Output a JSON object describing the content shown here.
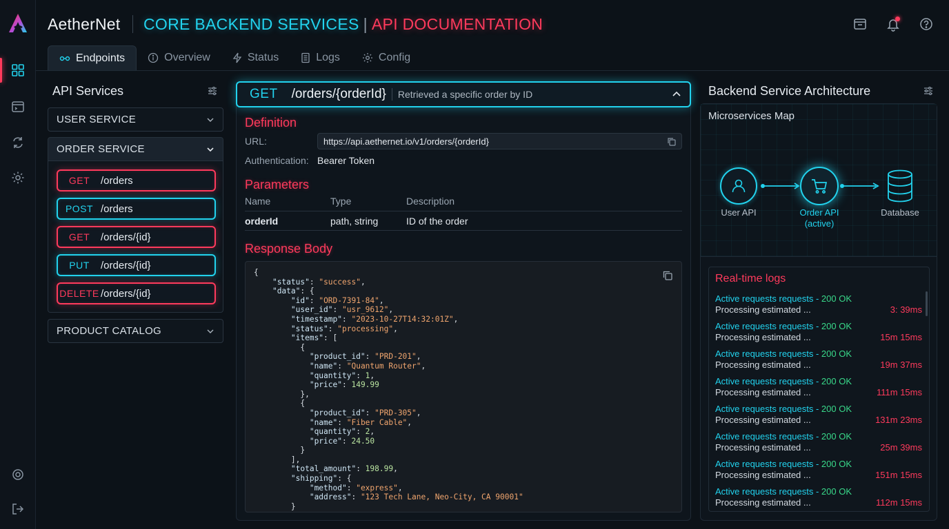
{
  "app": {
    "brand": "AetherNet",
    "title_part1": "CORE BACKEND SERVICES",
    "title_sep": "|",
    "title_part2": "API DOCUMENTATION"
  },
  "colors": {
    "accent_cyan": "#22d3ee",
    "accent_red": "#ff3a5c",
    "status_ok": "#39d98a",
    "background": "#0c1218"
  },
  "header_icons": [
    "archive-icon",
    "bell-icon",
    "help-icon"
  ],
  "rail_icons": [
    "dashboard-icon",
    "terminal-icon",
    "sync-icon",
    "gear-icon",
    "settings-icon",
    "logout-icon"
  ],
  "tabs": [
    {
      "label": "Endpoints",
      "icon": "link-icon",
      "active": true
    },
    {
      "label": "Overview",
      "icon": "info-icon"
    },
    {
      "label": "Status",
      "icon": "bolt-icon"
    },
    {
      "label": "Logs",
      "icon": "document-icon"
    },
    {
      "label": "Config",
      "icon": "gear-icon"
    }
  ],
  "services": {
    "title": "API Services",
    "groups": [
      {
        "label": "USER SERVICE",
        "expanded": false
      },
      {
        "label": "ORDER SERVICE",
        "expanded": true
      },
      {
        "label": "PRODUCT CATALOG",
        "expanded": false
      }
    ],
    "order_endpoints": [
      {
        "method": "GET",
        "path": "/orders"
      },
      {
        "method": "POST",
        "path": "/orders"
      },
      {
        "method": "GET",
        "path": "/orders/{id}"
      },
      {
        "method": "PUT",
        "path": "/orders/{id}"
      },
      {
        "method": "DELETE",
        "path": "/orders/{id}"
      }
    ]
  },
  "endpoint": {
    "method": "GET",
    "path": "/orders/{orderId}",
    "summary": "Retrieved a specific order by ID",
    "definition_title": "Definition",
    "url_label": "URL:",
    "url": "https://api.aethernet.io/v1/orders/{orderId}",
    "auth_label": "Authentication:",
    "auth": "Bearer Token",
    "parameters_title": "Parameters",
    "param_headers": [
      "Name",
      "Type",
      "Description"
    ],
    "params": [
      {
        "name": "orderId",
        "type": "path, string",
        "description": "ID of the order"
      }
    ],
    "response_title": "Response Body",
    "response_lines": [
      [
        "{"
      ],
      [
        "    ",
        "k:\"status\"",
        ": ",
        "s:\"success\"",
        ","
      ],
      [
        "    ",
        "k:\"data\"",
        ": {"
      ],
      [
        "        ",
        "k:\"id\"",
        ": ",
        "s:\"ORD-7391-84\"",
        ","
      ],
      [
        "        ",
        "k:\"user_id\"",
        ": ",
        "s:\"usr_9612\"",
        ","
      ],
      [
        "        ",
        "k:\"timestamp\"",
        ": ",
        "s:\"2023-10-27T14:32:01Z\"",
        ","
      ],
      [
        "        ",
        "k:\"status\"",
        ": ",
        "s:\"processing\"",
        ","
      ],
      [
        "        ",
        "k:\"items\"",
        ": ["
      ],
      [
        "          {"
      ],
      [
        "            ",
        "k:\"product_id\"",
        ": ",
        "s:\"PRD-201\"",
        ","
      ],
      [
        "            ",
        "k:\"name\"",
        ": ",
        "s:\"Quantum Router\"",
        ","
      ],
      [
        "            ",
        "k:\"quantity\"",
        ": ",
        "n:1",
        ","
      ],
      [
        "            ",
        "k:\"price\"",
        ": ",
        "n:149.99"
      ],
      [
        "          },"
      ],
      [
        "          {"
      ],
      [
        "            ",
        "k:\"product_id\"",
        ": ",
        "s:\"PRD-305\"",
        ","
      ],
      [
        "            ",
        "k:\"name\"",
        ": ",
        "s:\"Fiber Cable\"",
        ","
      ],
      [
        "            ",
        "k:\"quantity\"",
        ": ",
        "n:2",
        ","
      ],
      [
        "            ",
        "k:\"price\"",
        ": ",
        "n:24.50"
      ],
      [
        "          }"
      ],
      [
        "        ],"
      ],
      [
        "        ",
        "k:\"total_amount\"",
        ": ",
        "n:198.99",
        ","
      ],
      [
        "        ",
        "k:\"shipping\"",
        ": {"
      ],
      [
        "            ",
        "k:\"method\"",
        ": ",
        "s:\"express\"",
        ","
      ],
      [
        "            ",
        "k:\"address\"",
        ": ",
        "s:\"123 Tech Lane, Neo-City, CA 90001\""
      ],
      [
        "        }"
      ],
      [
        "    }"
      ]
    ]
  },
  "architecture": {
    "title": "Backend Service Architecture",
    "map_title": "Microservices Map",
    "nodes": [
      {
        "label": "User API",
        "icon": "user-icon"
      },
      {
        "label": "Order API",
        "sublabel": "(active)",
        "icon": "cart-icon",
        "active": true
      },
      {
        "label": "Database",
        "icon": "database-icon"
      }
    ]
  },
  "logs": {
    "title": "Real-time logs",
    "entries": [
      {
        "line1": "Active requests requests",
        "status": "200 OK",
        "line2": "Processing estimated ...",
        "time": "3: 39ms"
      },
      {
        "line1": "Active requests requests",
        "status": "200 OK",
        "line2": "Processing estimated ...",
        "time": "15m 15ms"
      },
      {
        "line1": "Active requests requests",
        "status": "200 OK",
        "line2": "Processing estimated ...",
        "time": "19m 37ms"
      },
      {
        "line1": "Active requests requests",
        "status": "200 OK",
        "line2": "Processing estimated ...",
        "time": "111m 15ms"
      },
      {
        "line1": "Active requests requests",
        "status": "200 OK",
        "line2": "Processing estimated ...",
        "time": "131m 23ms"
      },
      {
        "line1": "Active requests requests",
        "status": "200 OK",
        "line2": "Processing estimated ...",
        "time": "25m 39ms"
      },
      {
        "line1": "Active requests requests",
        "status": "200 OK",
        "line2": "Processing estimated ...",
        "time": "151m 15ms"
      },
      {
        "line1": "Active requests requests",
        "status": "200 OK",
        "line2": "Processing estimated ...",
        "time": "112m 15ms"
      }
    ]
  }
}
